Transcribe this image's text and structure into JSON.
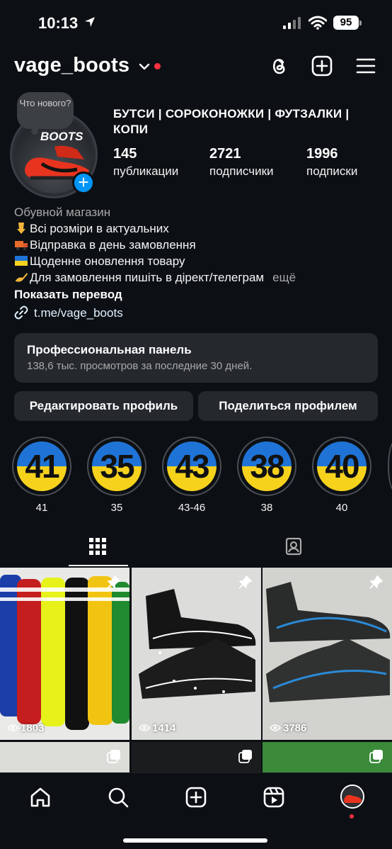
{
  "status_bar": {
    "time": "10:13",
    "battery": "95"
  },
  "header": {
    "username": "vage_boots"
  },
  "profile": {
    "note": "Что нового?",
    "avatar_logo": "BOOTS",
    "display_name": "БУТСИ | СОРОКОНОЖКИ | ФУТЗАЛКИ | КОПИ",
    "stats": [
      {
        "value": "145",
        "label": "публикации"
      },
      {
        "value": "2721",
        "label": "подписчики"
      },
      {
        "value": "1996",
        "label": "подписки"
      }
    ]
  },
  "bio": {
    "category": "Обувной магазин",
    "lines": [
      "Всі розміри в актуальних",
      "Відправка в день замовлення",
      "Щоденне оновлення товару",
      "Для замовлення пишіть в дірект/телеграм"
    ],
    "more": "ещё",
    "translate": "Показать перевод",
    "link": "t.me/vage_boots"
  },
  "pro_panel": {
    "title": "Профессиональная панель",
    "subtitle": "138,6 тыс. просмотров за последние 30 дней."
  },
  "buttons": {
    "edit": "Редактировать профиль",
    "share": "Поделиться профилем"
  },
  "highlights": [
    {
      "number": "41",
      "label": "41"
    },
    {
      "number": "35",
      "label": "35"
    },
    {
      "number": "43",
      "label": "43-46"
    },
    {
      "number": "38",
      "label": "38"
    },
    {
      "number": "40",
      "label": "40"
    }
  ],
  "posts": [
    {
      "views": "1803"
    },
    {
      "views": "1414"
    },
    {
      "views": "3786"
    }
  ],
  "colors": {
    "accent": "#0095f6",
    "background": "#0c1014",
    "notification": "#ff3040",
    "ukraine_blue": "#1f73d6",
    "ukraine_yellow": "#f6d21d"
  }
}
